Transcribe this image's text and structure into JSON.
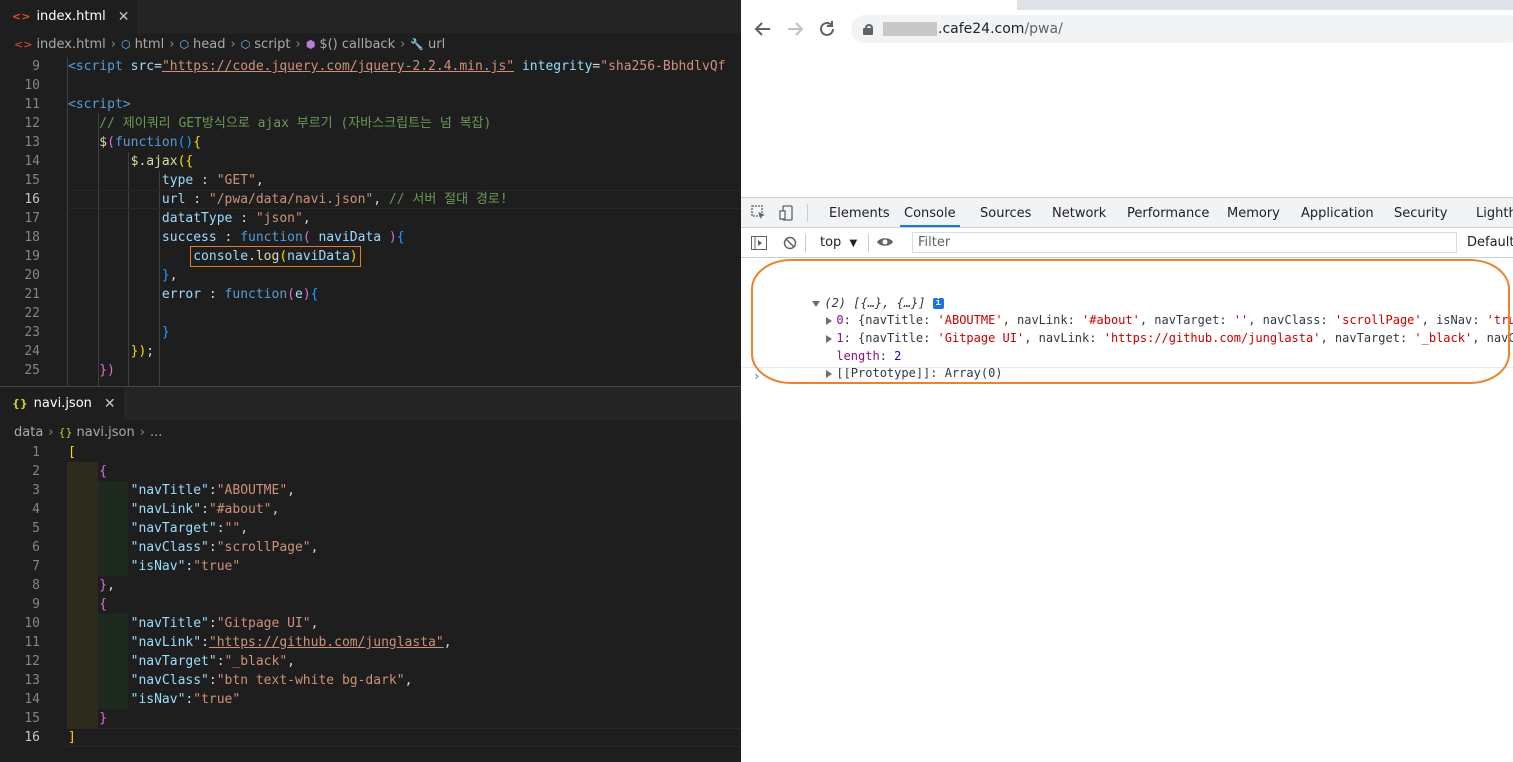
{
  "editor_top": {
    "tab": {
      "icon": "<>",
      "label": "index.html",
      "close": "✕"
    },
    "breadcrumbs": [
      "index.html",
      "html",
      "head",
      "script",
      "$() callback",
      "url"
    ],
    "lines": [
      {
        "n": "9",
        "segments": [
          [
            "t-tag",
            "<script "
          ],
          [
            "t-attr",
            "src"
          ],
          [
            "t-plain",
            "="
          ],
          [
            "t-url",
            "\"https://code.jquery.com/jquery-2.2.4.min.js\""
          ],
          [
            "t-plain",
            " "
          ],
          [
            "t-attr",
            "integrity"
          ],
          [
            "t-plain",
            "="
          ],
          [
            "t-str",
            "\"sha256-BbhdlvQf"
          ]
        ]
      },
      {
        "n": "10",
        "segments": []
      },
      {
        "n": "11",
        "segments": [
          [
            "t-tag",
            "<script>"
          ]
        ]
      },
      {
        "n": "12",
        "segments": [
          [
            "t-com",
            "    // 제이쿼리 GET방식으로 ajax 부르기 (자바스크립트는 넘 복잡)"
          ]
        ]
      },
      {
        "n": "13",
        "segments": [
          [
            "t-fn",
            "    $"
          ],
          [
            "t-par",
            "("
          ],
          [
            "t-kw",
            "function"
          ],
          [
            "t-br2",
            "()"
          ],
          [
            "t-br",
            "{"
          ]
        ]
      },
      {
        "n": "14",
        "segments": [
          [
            "t-fn",
            "        $"
          ],
          [
            "t-plain",
            "."
          ],
          [
            "t-fn",
            "ajax"
          ],
          [
            "t-br",
            "({"
          ]
        ]
      },
      {
        "n": "15",
        "segments": [
          [
            "t-prop",
            "            type"
          ],
          [
            "t-plain",
            " : "
          ],
          [
            "t-str",
            "\"GET\""
          ],
          [
            "t-plain",
            ","
          ]
        ]
      },
      {
        "n": "16",
        "segments": [
          [
            "t-prop",
            "            url"
          ],
          [
            "t-plain",
            " : "
          ],
          [
            "t-str",
            "\"/pwa/data/navi.json\""
          ],
          [
            "t-plain",
            ", "
          ],
          [
            "t-com",
            "// 서버 절대 경로!"
          ]
        ]
      },
      {
        "n": "17",
        "segments": [
          [
            "t-prop",
            "            datatType"
          ],
          [
            "t-plain",
            " : "
          ],
          [
            "t-str",
            "\"json\""
          ],
          [
            "t-plain",
            ","
          ]
        ]
      },
      {
        "n": "18",
        "segments": [
          [
            "t-prop",
            "            success"
          ],
          [
            "t-plain",
            " : "
          ],
          [
            "t-kw",
            "function"
          ],
          [
            "t-par",
            "( "
          ],
          [
            "t-prop",
            "naviData"
          ],
          [
            "t-par",
            " )"
          ],
          [
            "t-br2",
            "{"
          ]
        ]
      },
      {
        "n": "19",
        "segments": [
          [
            "t-plain",
            "                "
          ],
          [
            "t-prop hilite",
            "console"
          ],
          [
            "t-plain hilite",
            "."
          ],
          [
            "t-fn hilite",
            "log"
          ],
          [
            "t-br hilite",
            "("
          ],
          [
            "t-prop hilite",
            "naviData"
          ],
          [
            "t-br hilite",
            ")"
          ]
        ]
      },
      {
        "n": "20",
        "segments": [
          [
            "t-br2",
            "            }"
          ],
          [
            "t-plain",
            ","
          ]
        ]
      },
      {
        "n": "21",
        "segments": [
          [
            "t-prop",
            "            error"
          ],
          [
            "t-plain",
            " : "
          ],
          [
            "t-kw",
            "function"
          ],
          [
            "t-par",
            "("
          ],
          [
            "t-prop",
            "e"
          ],
          [
            "t-par",
            ")"
          ],
          [
            "t-br2",
            "{"
          ]
        ]
      },
      {
        "n": "22",
        "segments": []
      },
      {
        "n": "23",
        "segments": [
          [
            "t-br2",
            "            }"
          ]
        ]
      },
      {
        "n": "24",
        "segments": [
          [
            "t-br",
            "        })"
          ],
          [
            "t-plain",
            ";"
          ]
        ]
      },
      {
        "n": "25",
        "segments": [
          [
            "t-par",
            "    })"
          ]
        ]
      }
    ]
  },
  "editor_bottom": {
    "tab": {
      "icon": "{}",
      "label": "navi.json",
      "close": "✕"
    },
    "breadcrumbs": [
      "data",
      "navi.json",
      "..."
    ],
    "lines": [
      {
        "n": "1",
        "segments": [
          [
            "t-br",
            "["
          ]
        ]
      },
      {
        "n": "2",
        "segments": [
          [
            "t-par",
            "    {"
          ]
        ]
      },
      {
        "n": "3",
        "segments": [
          [
            "t-prop",
            "        \"navTitle\""
          ],
          [
            "t-plain",
            ":"
          ],
          [
            "t-str",
            "\"ABOUTME\""
          ],
          [
            "t-plain",
            ","
          ]
        ]
      },
      {
        "n": "4",
        "segments": [
          [
            "t-prop",
            "        \"navLink\""
          ],
          [
            "t-plain",
            ":"
          ],
          [
            "t-str",
            "\"#about\""
          ],
          [
            "t-plain",
            ","
          ]
        ]
      },
      {
        "n": "5",
        "segments": [
          [
            "t-prop",
            "        \"navTarget\""
          ],
          [
            "t-plain",
            ":"
          ],
          [
            "t-str",
            "\"\""
          ],
          [
            "t-plain",
            ","
          ]
        ]
      },
      {
        "n": "6",
        "segments": [
          [
            "t-prop",
            "        \"navClass\""
          ],
          [
            "t-plain",
            ":"
          ],
          [
            "t-str",
            "\"scrollPage\""
          ],
          [
            "t-plain",
            ","
          ]
        ]
      },
      {
        "n": "7",
        "segments": [
          [
            "t-prop",
            "        \"isNav\""
          ],
          [
            "t-plain",
            ":"
          ],
          [
            "t-str",
            "\"true\""
          ]
        ]
      },
      {
        "n": "8",
        "segments": [
          [
            "t-par",
            "    }"
          ],
          [
            "t-plain",
            ","
          ]
        ]
      },
      {
        "n": "9",
        "segments": [
          [
            "t-par",
            "    {"
          ]
        ]
      },
      {
        "n": "10",
        "segments": [
          [
            "t-prop",
            "        \"navTitle\""
          ],
          [
            "t-plain",
            ":"
          ],
          [
            "t-str",
            "\"Gitpage UI\""
          ],
          [
            "t-plain",
            ","
          ]
        ]
      },
      {
        "n": "11",
        "segments": [
          [
            "t-prop",
            "        \"navLink\""
          ],
          [
            "t-plain",
            ":"
          ],
          [
            "t-url",
            "\"https://github.com/junglasta\""
          ],
          [
            "t-plain",
            ","
          ]
        ]
      },
      {
        "n": "12",
        "segments": [
          [
            "t-prop",
            "        \"navTarget\""
          ],
          [
            "t-plain",
            ":"
          ],
          [
            "t-str",
            "\"_black\""
          ],
          [
            "t-plain",
            ","
          ]
        ]
      },
      {
        "n": "13",
        "segments": [
          [
            "t-prop",
            "        \"navClass\""
          ],
          [
            "t-plain",
            ":"
          ],
          [
            "t-str",
            "\"btn text-white bg-dark\""
          ],
          [
            "t-plain",
            ","
          ]
        ]
      },
      {
        "n": "14",
        "segments": [
          [
            "t-prop",
            "        \"isNav\""
          ],
          [
            "t-plain",
            ":"
          ],
          [
            "t-str",
            "\"true\""
          ]
        ]
      },
      {
        "n": "15",
        "segments": [
          [
            "t-par",
            "    }"
          ]
        ]
      },
      {
        "n": "16",
        "segments": [
          [
            "t-br",
            "]"
          ]
        ]
      }
    ]
  },
  "browser": {
    "url_host_suffix": ".cafe24.com",
    "url_path": "/pwa/"
  },
  "devtools": {
    "tabs": [
      "Elements",
      "Console",
      "Sources",
      "Network",
      "Performance",
      "Memory",
      "Application",
      "Security",
      "Lighth"
    ],
    "active_tab": "Console",
    "context": "top",
    "filter_placeholder": "Filter",
    "levels": "Default",
    "console": {
      "summary": "(2) [{…}, {…}]",
      "info_badge": "i",
      "items": [
        {
          "index": "0",
          "text": [
            [
              "c-key",
              "{navTitle: "
            ],
            [
              "c-str",
              "'ABOUTME'"
            ],
            [
              "c-key",
              ", navLink: "
            ],
            [
              "c-str",
              "'#about'"
            ],
            [
              "c-key",
              ", navTarget: "
            ],
            [
              "c-str",
              "''"
            ],
            [
              "c-key",
              ", navClass: "
            ],
            [
              "c-str",
              "'scrollPage'"
            ],
            [
              "c-key",
              ", isNav: "
            ],
            [
              "c-str",
              "'true'"
            ],
            [
              "c-key",
              "}"
            ]
          ]
        },
        {
          "index": "1",
          "text": [
            [
              "c-key",
              "{navTitle: "
            ],
            [
              "c-str",
              "'Gitpage UI'"
            ],
            [
              "c-key",
              ", navLink: "
            ],
            [
              "c-str",
              "'https://github.com/junglasta'"
            ],
            [
              "c-key",
              ", navTarget: "
            ],
            [
              "c-str",
              "'_black'"
            ],
            [
              "c-key",
              ", navClass:"
            ]
          ]
        }
      ],
      "length_label": "length",
      "length_value": "2",
      "prototype": "[[Prototype]]: Array(0)",
      "prompt": "›"
    }
  },
  "colors": {
    "highlight": "#e8842e",
    "accent": "#1a73e8"
  }
}
